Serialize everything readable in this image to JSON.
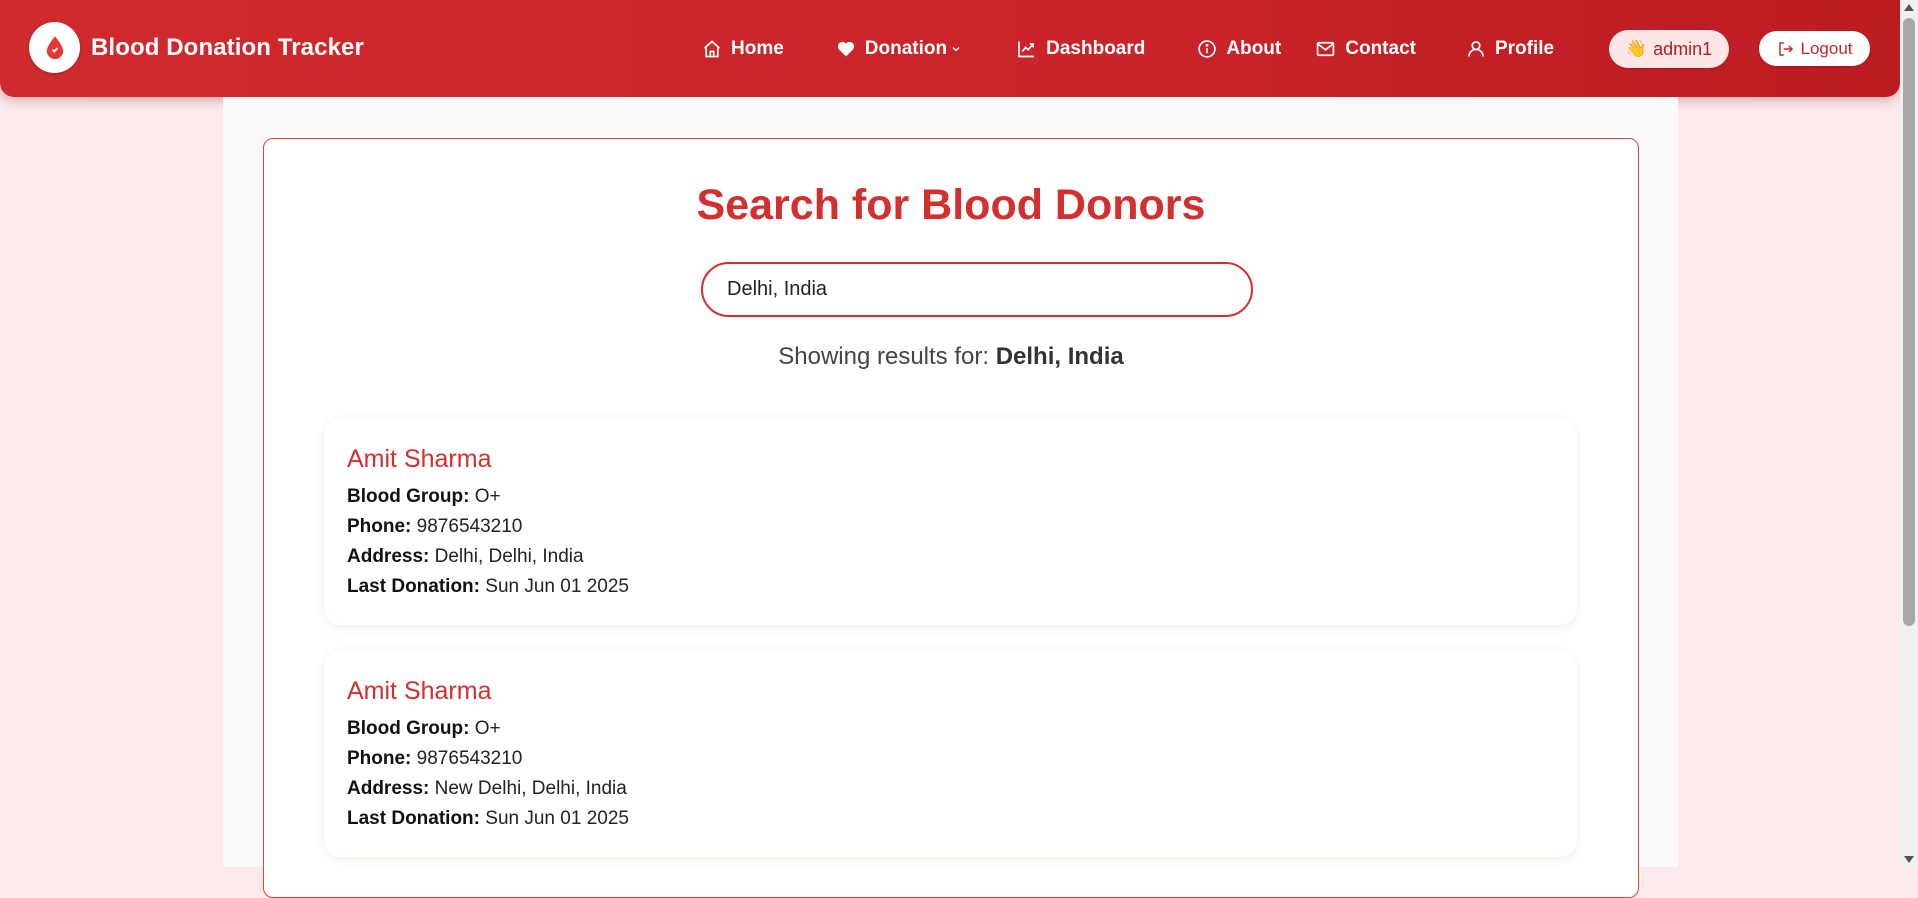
{
  "brand": {
    "title": "Blood Donation Tracker"
  },
  "nav": {
    "home": "Home",
    "donation": "Donation",
    "dashboard": "Dashboard",
    "about": "About",
    "contact": "Contact",
    "profile": "Profile"
  },
  "user": {
    "wave": "👋",
    "name": "admin1"
  },
  "logout": "Logout",
  "search": {
    "title": "Search for Blood Donors",
    "value": "Delhi, India",
    "results_prefix": "Showing results for:",
    "results_query": "Delhi, India"
  },
  "labels": {
    "blood_group": "Blood Group:",
    "phone": "Phone:",
    "address": "Address:",
    "last_donation": "Last Donation:"
  },
  "donors": [
    {
      "name": "Amit Sharma",
      "blood_group": "O+",
      "phone": "9876543210",
      "address": "Delhi, Delhi, India",
      "last_donation": "Sun Jun 01 2025"
    },
    {
      "name": "Amit Sharma",
      "blood_group": "O+",
      "phone": "9876543210",
      "address": "New Delhi, Delhi, India",
      "last_donation": "Sun Jun 01 2025"
    }
  ],
  "colors": {
    "brand_red": "#d32f2f",
    "nav_bg": "#c9242a",
    "page_bg": "#fdeaea"
  }
}
